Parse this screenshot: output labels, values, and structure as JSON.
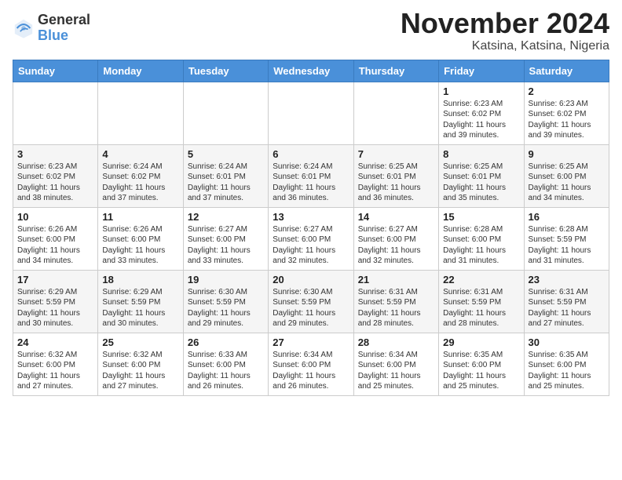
{
  "header": {
    "logo": {
      "general": "General",
      "blue": "Blue"
    },
    "month": "November 2024",
    "location": "Katsina, Katsina, Nigeria"
  },
  "weekdays": [
    "Sunday",
    "Monday",
    "Tuesday",
    "Wednesday",
    "Thursday",
    "Friday",
    "Saturday"
  ],
  "weeks": [
    [
      {
        "day": "",
        "info": ""
      },
      {
        "day": "",
        "info": ""
      },
      {
        "day": "",
        "info": ""
      },
      {
        "day": "",
        "info": ""
      },
      {
        "day": "",
        "info": ""
      },
      {
        "day": "1",
        "info": "Sunrise: 6:23 AM\nSunset: 6:02 PM\nDaylight: 11 hours and 39 minutes."
      },
      {
        "day": "2",
        "info": "Sunrise: 6:23 AM\nSunset: 6:02 PM\nDaylight: 11 hours and 39 minutes."
      }
    ],
    [
      {
        "day": "3",
        "info": "Sunrise: 6:23 AM\nSunset: 6:02 PM\nDaylight: 11 hours and 38 minutes."
      },
      {
        "day": "4",
        "info": "Sunrise: 6:24 AM\nSunset: 6:02 PM\nDaylight: 11 hours and 37 minutes."
      },
      {
        "day": "5",
        "info": "Sunrise: 6:24 AM\nSunset: 6:01 PM\nDaylight: 11 hours and 37 minutes."
      },
      {
        "day": "6",
        "info": "Sunrise: 6:24 AM\nSunset: 6:01 PM\nDaylight: 11 hours and 36 minutes."
      },
      {
        "day": "7",
        "info": "Sunrise: 6:25 AM\nSunset: 6:01 PM\nDaylight: 11 hours and 36 minutes."
      },
      {
        "day": "8",
        "info": "Sunrise: 6:25 AM\nSunset: 6:01 PM\nDaylight: 11 hours and 35 minutes."
      },
      {
        "day": "9",
        "info": "Sunrise: 6:25 AM\nSunset: 6:00 PM\nDaylight: 11 hours and 34 minutes."
      }
    ],
    [
      {
        "day": "10",
        "info": "Sunrise: 6:26 AM\nSunset: 6:00 PM\nDaylight: 11 hours and 34 minutes."
      },
      {
        "day": "11",
        "info": "Sunrise: 6:26 AM\nSunset: 6:00 PM\nDaylight: 11 hours and 33 minutes."
      },
      {
        "day": "12",
        "info": "Sunrise: 6:27 AM\nSunset: 6:00 PM\nDaylight: 11 hours and 33 minutes."
      },
      {
        "day": "13",
        "info": "Sunrise: 6:27 AM\nSunset: 6:00 PM\nDaylight: 11 hours and 32 minutes."
      },
      {
        "day": "14",
        "info": "Sunrise: 6:27 AM\nSunset: 6:00 PM\nDaylight: 11 hours and 32 minutes."
      },
      {
        "day": "15",
        "info": "Sunrise: 6:28 AM\nSunset: 6:00 PM\nDaylight: 11 hours and 31 minutes."
      },
      {
        "day": "16",
        "info": "Sunrise: 6:28 AM\nSunset: 5:59 PM\nDaylight: 11 hours and 31 minutes."
      }
    ],
    [
      {
        "day": "17",
        "info": "Sunrise: 6:29 AM\nSunset: 5:59 PM\nDaylight: 11 hours and 30 minutes."
      },
      {
        "day": "18",
        "info": "Sunrise: 6:29 AM\nSunset: 5:59 PM\nDaylight: 11 hours and 30 minutes."
      },
      {
        "day": "19",
        "info": "Sunrise: 6:30 AM\nSunset: 5:59 PM\nDaylight: 11 hours and 29 minutes."
      },
      {
        "day": "20",
        "info": "Sunrise: 6:30 AM\nSunset: 5:59 PM\nDaylight: 11 hours and 29 minutes."
      },
      {
        "day": "21",
        "info": "Sunrise: 6:31 AM\nSunset: 5:59 PM\nDaylight: 11 hours and 28 minutes."
      },
      {
        "day": "22",
        "info": "Sunrise: 6:31 AM\nSunset: 5:59 PM\nDaylight: 11 hours and 28 minutes."
      },
      {
        "day": "23",
        "info": "Sunrise: 6:31 AM\nSunset: 5:59 PM\nDaylight: 11 hours and 27 minutes."
      }
    ],
    [
      {
        "day": "24",
        "info": "Sunrise: 6:32 AM\nSunset: 6:00 PM\nDaylight: 11 hours and 27 minutes."
      },
      {
        "day": "25",
        "info": "Sunrise: 6:32 AM\nSunset: 6:00 PM\nDaylight: 11 hours and 27 minutes."
      },
      {
        "day": "26",
        "info": "Sunrise: 6:33 AM\nSunset: 6:00 PM\nDaylight: 11 hours and 26 minutes."
      },
      {
        "day": "27",
        "info": "Sunrise: 6:34 AM\nSunset: 6:00 PM\nDaylight: 11 hours and 26 minutes."
      },
      {
        "day": "28",
        "info": "Sunrise: 6:34 AM\nSunset: 6:00 PM\nDaylight: 11 hours and 25 minutes."
      },
      {
        "day": "29",
        "info": "Sunrise: 6:35 AM\nSunset: 6:00 PM\nDaylight: 11 hours and 25 minutes."
      },
      {
        "day": "30",
        "info": "Sunrise: 6:35 AM\nSunset: 6:00 PM\nDaylight: 11 hours and 25 minutes."
      }
    ]
  ]
}
